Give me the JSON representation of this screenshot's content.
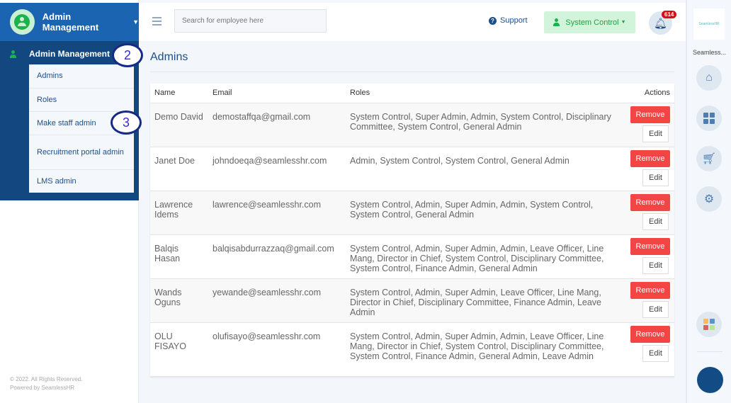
{
  "sidebar": {
    "title": "Admin Management",
    "section": "Admin Management",
    "items": [
      "Admins",
      "Roles",
      "Make staff admin",
      "Recruitment portal admin",
      "LMS admin"
    ],
    "footer_line1": "© 2022. All Rights Reserved.",
    "footer_line2": "Powered by SeamlessHR"
  },
  "callouts": [
    "2",
    "3"
  ],
  "topbar": {
    "search_placeholder": "Search for employee here",
    "support": "Support",
    "system_control": "System Control",
    "notifications": "614"
  },
  "page": {
    "title": "Admins"
  },
  "table": {
    "headers": [
      "Name",
      "Email",
      "Roles",
      "Actions"
    ],
    "remove_label": "Remove",
    "edit_label": "Edit",
    "rows": [
      {
        "name": "Demo David",
        "email": "demostaffqa@gmail.com",
        "roles": "System Control, Super Admin, Admin, System Control, Disciplinary Committee, System Control, General Admin"
      },
      {
        "name": "Janet Doe",
        "email": "johndoeqa@seamlesshr.com",
        "roles": "Admin, System Control, System Control, General Admin"
      },
      {
        "name": "Lawrence Idems",
        "email": "lawrence@seamlesshr.com",
        "roles": "System Control, Admin, Super Admin, Admin, System Control, System Control, General Admin"
      },
      {
        "name": "Balqis Hasan",
        "email": "balqisabdurrazzaq@gmail.com",
        "roles": "System Control, Admin, Super Admin, Admin, Leave Officer, Line Mang, Director in Chief, System Control, Disciplinary Committee, System Control, Finance Admin, General Admin"
      },
      {
        "name": "Wands Oguns",
        "email": "yewande@seamlesshr.com",
        "roles": "System Control, Admin, Super Admin, Leave Officer, Line Mang, Director in Chief, Disciplinary Committee, Finance Admin, Leave Admin"
      },
      {
        "name": "OLU FISAYO",
        "email": "olufisayo@seamlesshr.com",
        "roles": "System Control, Admin, Super Admin, Admin, Leave Officer, Line Mang, Director in Chief, System Control, Disciplinary Committee, System Control, Finance Admin, General Admin, Leave Admin"
      }
    ]
  },
  "rail": {
    "logo": "SeamlessHR",
    "name": "Seamless..."
  }
}
